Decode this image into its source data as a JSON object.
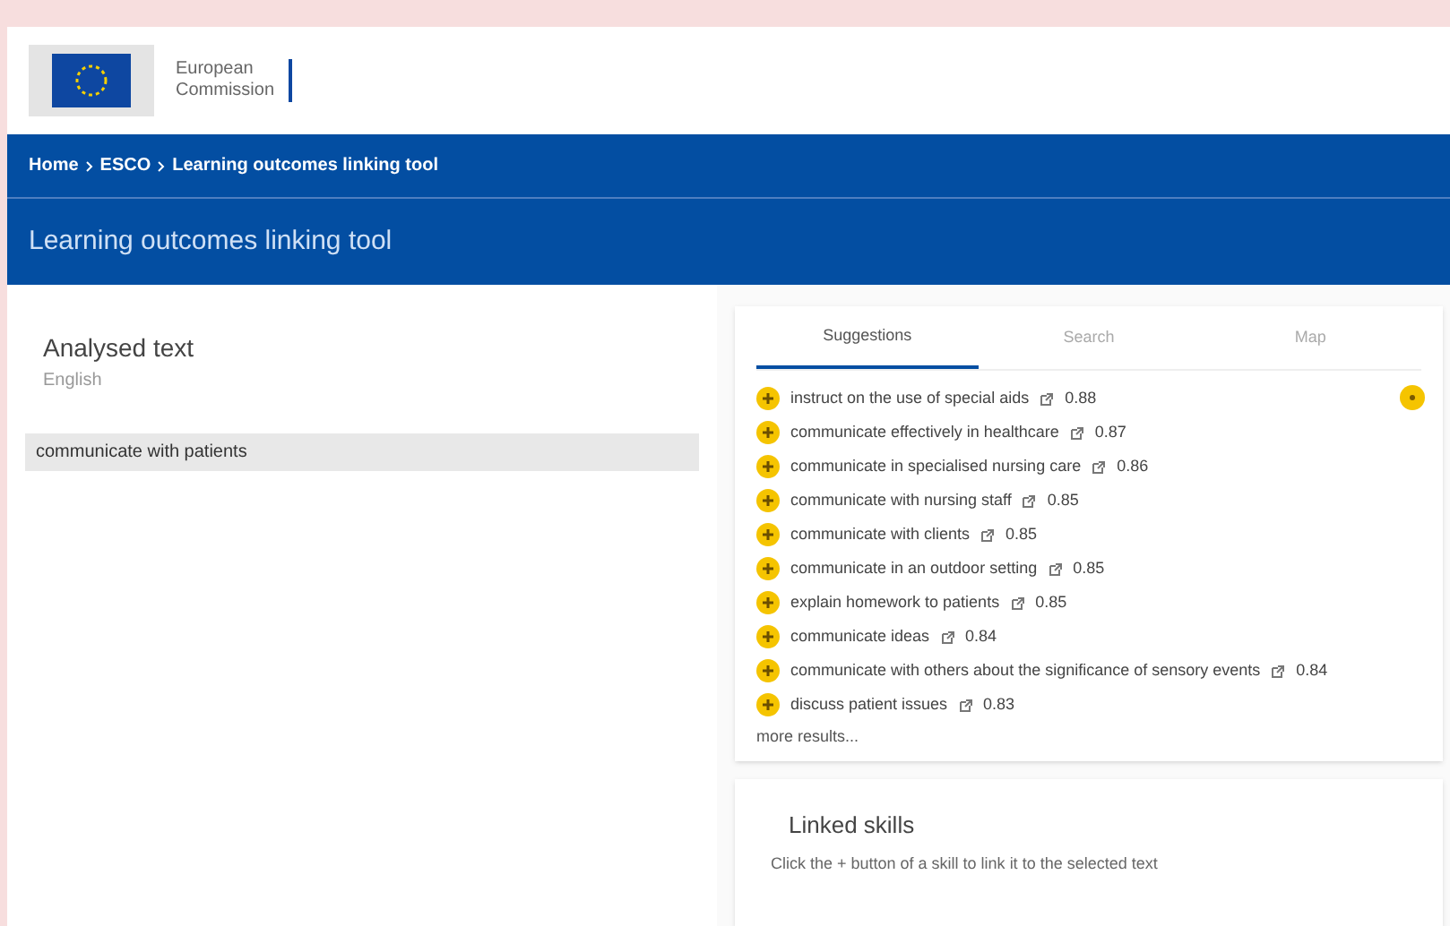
{
  "header": {
    "logo_text": [
      "European",
      "Commission"
    ]
  },
  "breadcrumb": [
    "Home",
    "ESCO",
    "Learning outcomes linking tool"
  ],
  "page_title": "Learning outcomes linking tool",
  "analysed": {
    "title": "Analysed text",
    "language": "English",
    "lines": [
      {
        "text": "communicate with patients",
        "selected": true
      }
    ]
  },
  "tabs": [
    {
      "label": "Suggestions",
      "selected": true
    },
    {
      "label": "Search",
      "selected": false
    },
    {
      "label": "Map",
      "selected": false
    }
  ],
  "suggestions": [
    {
      "skill": "instruct on the use of special aids",
      "score": "0.88"
    },
    {
      "skill": "communicate effectively in healthcare",
      "score": "0.87"
    },
    {
      "skill": "communicate in specialised nursing care",
      "score": "0.86"
    },
    {
      "skill": "communicate with nursing staff",
      "score": "0.85"
    },
    {
      "skill": "communicate with clients",
      "score": "0.85"
    },
    {
      "skill": "communicate in an outdoor setting",
      "score": "0.85"
    },
    {
      "skill": "explain homework to patients",
      "score": "0.85"
    },
    {
      "skill": "communicate ideas",
      "score": "0.84"
    },
    {
      "skill": "communicate with others about the significance of sensory events",
      "score": "0.84"
    },
    {
      "skill": "discuss patient issues",
      "score": "0.83"
    }
  ],
  "more_results": "more results...",
  "linked_skills": {
    "title": "Linked skills",
    "hint": "Click the + button of a skill to link it to the selected text"
  }
}
